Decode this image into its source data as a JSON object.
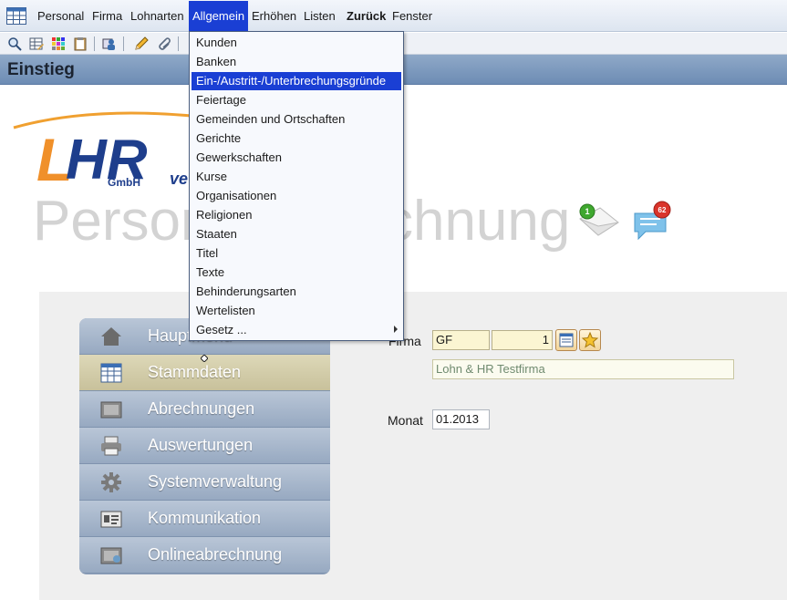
{
  "menubar": {
    "items": [
      {
        "label": "Personal"
      },
      {
        "label": "Firma"
      },
      {
        "label": "Lohnarten"
      },
      {
        "label": "Allgemein",
        "active": true
      },
      {
        "label": "Erhöhen"
      },
      {
        "label": "Listen"
      },
      {
        "label": "Zurück"
      },
      {
        "label": "Fenster"
      }
    ]
  },
  "page": {
    "title": "Einstieg",
    "logo": {
      "letters": "LHR",
      "sub": "GmbH",
      "tail": "ve"
    },
    "hero_text": "Personalverrechnung",
    "mail_badge": "1",
    "chat_badge": "62"
  },
  "nav": {
    "items": [
      {
        "label": "Hauptmenü",
        "icon": "home-icon"
      },
      {
        "label": "Stammdaten",
        "icon": "table-icon",
        "selected": true
      },
      {
        "label": "Abrechnungen",
        "icon": "invoice-icon"
      },
      {
        "label": "Auswertungen",
        "icon": "printer-icon"
      },
      {
        "label": "Systemverwaltung",
        "icon": "gear-icon"
      },
      {
        "label": "Kommunikation",
        "icon": "id-card-icon"
      },
      {
        "label": "Onlineabrechnung",
        "icon": "online-invoice-icon"
      }
    ]
  },
  "form": {
    "firma_label": "Firma",
    "firma_code": "GF",
    "firma_number": "1",
    "firma_name": "Lohn & HR Testfirma",
    "monat_label": "Monat",
    "monat_value": "01.2013"
  },
  "dropdown": {
    "items": [
      {
        "label": "Kunden"
      },
      {
        "label": "Banken"
      },
      {
        "label": "Ein-/Austritt-/Unterbrechungsgründe",
        "highlighted": true
      },
      {
        "label": "Feiertage"
      },
      {
        "label": "Gemeinden und Ortschaften"
      },
      {
        "label": "Gerichte"
      },
      {
        "label": "Gewerkschaften"
      },
      {
        "label": "Kurse"
      },
      {
        "label": "Organisationen"
      },
      {
        "label": "Religionen"
      },
      {
        "label": "Staaten"
      },
      {
        "label": "Titel"
      },
      {
        "label": "Texte"
      },
      {
        "label": "Behinderungsarten"
      },
      {
        "label": "Wertelisten"
      },
      {
        "label": "Gesetz ...",
        "submenu": true
      }
    ]
  },
  "colors": {
    "accent": "#1a3fd4",
    "titlebar": "#7b97bd",
    "nav": "#a5b5cb",
    "nav_selected": "#d2cba8",
    "field": "#fbf5d2"
  }
}
